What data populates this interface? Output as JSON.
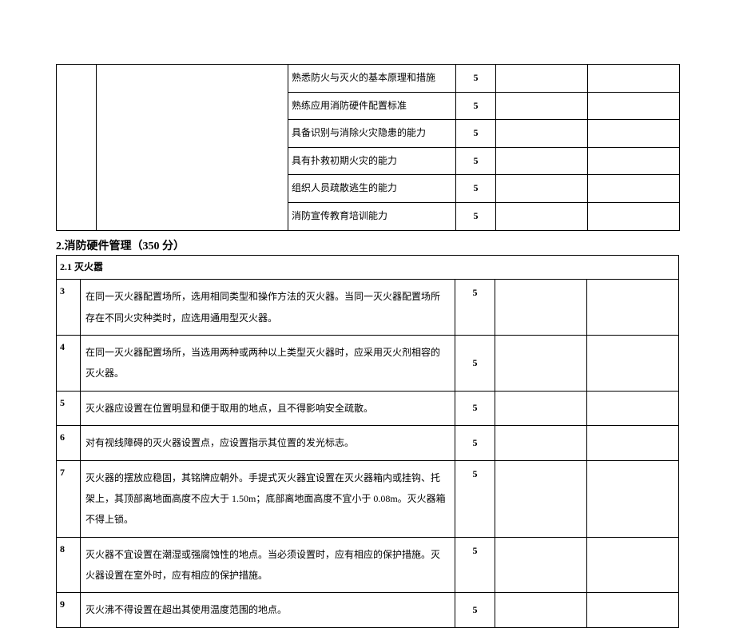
{
  "table1": {
    "rows": [
      {
        "desc": "熟悉防火与灭火的基本原理和措施",
        "score": "5"
      },
      {
        "desc": "熟练应用消防硬件配置标准",
        "score": "5"
      },
      {
        "desc": "具备识别与消除火灾隐患的能力",
        "score": "5"
      },
      {
        "desc": "具有扑救初期火灾的能力",
        "score": "5"
      },
      {
        "desc": "组织人员疏散逃生的能力",
        "score": "5"
      },
      {
        "desc": "消防宣传教育培训能力",
        "score": "5"
      }
    ]
  },
  "section2": {
    "title": "2.消防硬件管理（350 分）",
    "subsection": "2.1 灭火嚣",
    "rows": [
      {
        "idx": "3",
        "desc": "在同一灭火器配置场所，选用相同类型和操作方法的灭火器。当同一灭火器配置场所存在不同火灾种类时，应选用通用型灭火器。",
        "score": "5"
      },
      {
        "idx": "4",
        "desc": "在同一灭火器配置场所，当选用两种或两种以上类型灭火器时，应采用灭火剂相容的灭火器。",
        "score": "5"
      },
      {
        "idx": "5",
        "desc": "灭火器应设置在位置明显和便于取用的地点，且不得影响安全疏散。",
        "score": "5"
      },
      {
        "idx": "6",
        "desc": "对有视线障碍的灭火器设置点，应设置指示其位置的发光标志。",
        "score": "5"
      },
      {
        "idx": "7",
        "desc": "灭火器的摆放应稳固，其铭牌应朝外。手提式灭火器宜设置在灭火器箱内或挂钩、托架上，其顶部离地面高度不应大于 1.50m；底部离地面高度不宜小于 0.08m。灭火器箱不得上锁。",
        "score": "5"
      },
      {
        "idx": "8",
        "desc": "灭火器不宜设置在潮湿或强腐蚀性的地点。当必须设置时，应有相应的保护措施。灭火器设置在室外时，应有相应的保护措施。",
        "score": "5"
      },
      {
        "idx": "9",
        "desc": "灭火沸不得设置在超出其使用温度范围的地点。",
        "score": "5"
      }
    ]
  }
}
